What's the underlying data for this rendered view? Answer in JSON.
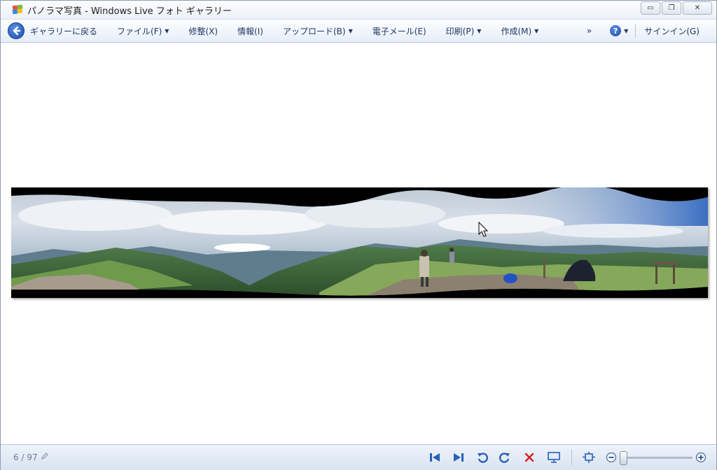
{
  "window": {
    "title": "パノラマ写真 - Windows  Live フォト ギャラリー",
    "min_glyph": "▭",
    "max_glyph": "❐",
    "close_glyph": "✕"
  },
  "toolbar": {
    "back_label": "ギャラリーに戻る",
    "file_label": "ファイル(F)",
    "fix_label": "修整(X)",
    "info_label": "情報(I)",
    "upload_label": "アップロード(B)",
    "email_label": "電子メール(E)",
    "print_label": "印刷(P)",
    "create_label": "作成(M)",
    "more_label": "»",
    "help_glyph": "?",
    "signin_label": "サインイン(G)"
  },
  "status": {
    "counter": "6 / 97"
  },
  "colors": {
    "accent": "#1f4fb2",
    "delete_red": "#d81e1e",
    "nav_blue": "#2a5fb8"
  },
  "icons": [
    "windows-live-photo-gallery-icon",
    "back-arrow-icon",
    "help-icon",
    "edit-pencil-icon",
    "previous-icon",
    "next-icon",
    "rotate-counterclockwise-icon",
    "rotate-clockwise-icon",
    "delete-icon",
    "slideshow-icon",
    "actual-size-icon",
    "zoom-out-icon",
    "zoom-in-icon",
    "mouse-cursor-icon"
  ],
  "zoom": {
    "level": 0.0
  }
}
